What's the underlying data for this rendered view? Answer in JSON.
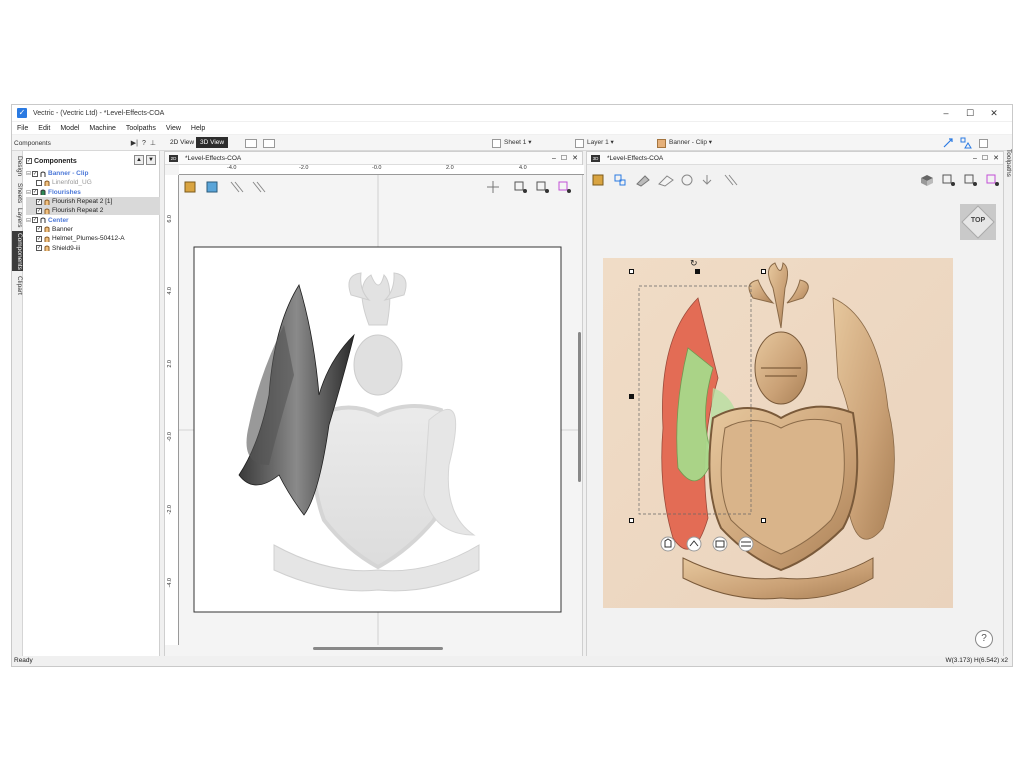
{
  "window": {
    "title": "Vectric - (Vectric Ltd) - *Level-Effects-COA",
    "controls": [
      "–",
      "☐",
      "✕"
    ]
  },
  "menu": [
    "File",
    "Edit",
    "Model",
    "Machine",
    "Toolpaths",
    "View",
    "Help"
  ],
  "toolbar": {
    "view2d_label": "2D View",
    "view3d_label": "3D View",
    "sheet_label": "Sheet 1 ▾",
    "layer_label": "Layer 1 ▾",
    "component_label": "Banner - Clip ▾"
  },
  "left_panel": {
    "header": "Components",
    "tabs": [
      "Design",
      "Sheets",
      "Layers",
      "Components",
      "Clipart"
    ],
    "active_tab": "Components",
    "section_title": "Components",
    "tree": [
      {
        "label": "Banner - Clip",
        "kind": "group",
        "level": 0
      },
      {
        "label": "Linenfold_UG",
        "kind": "muted",
        "level": 1
      },
      {
        "label": "Flourishes",
        "kind": "group",
        "level": 0
      },
      {
        "label": "Flourish Repeat 2 [1]",
        "kind": "selected",
        "level": 1
      },
      {
        "label": "Flourish Repeat 2",
        "kind": "selected",
        "level": 1
      },
      {
        "label": "Center",
        "kind": "group",
        "level": 0
      },
      {
        "label": "Banner",
        "kind": "item",
        "level": 1
      },
      {
        "label": "Helmet_Plumes-50412-A",
        "kind": "item",
        "level": 1
      },
      {
        "label": "Shield9-iii",
        "kind": "item",
        "level": 1
      }
    ]
  },
  "view2d": {
    "badge": "2D",
    "title": "*Level-Effects-COA",
    "ruler_top": [
      "-4.0",
      "-2.0",
      "-0.0",
      "2.0",
      "4.0"
    ],
    "ruler_left": [
      "6.0",
      "4.0",
      "2.0",
      "-0.0",
      "-2.0",
      "-4.0"
    ]
  },
  "view3d": {
    "badge": "3D",
    "title": "*Level-Effects-COA",
    "cube_label": "TOP",
    "help": "?"
  },
  "right_tab": "Toolpaths",
  "status": {
    "left": "Ready",
    "right": "W(3.173) H(6.542) x2"
  },
  "colors": {
    "accent": "#2a7ae2",
    "group_text": "#4d79d8",
    "wood": "#d9b48a",
    "highlight_red": "#e06a55",
    "highlight_green": "#a8d98a"
  }
}
